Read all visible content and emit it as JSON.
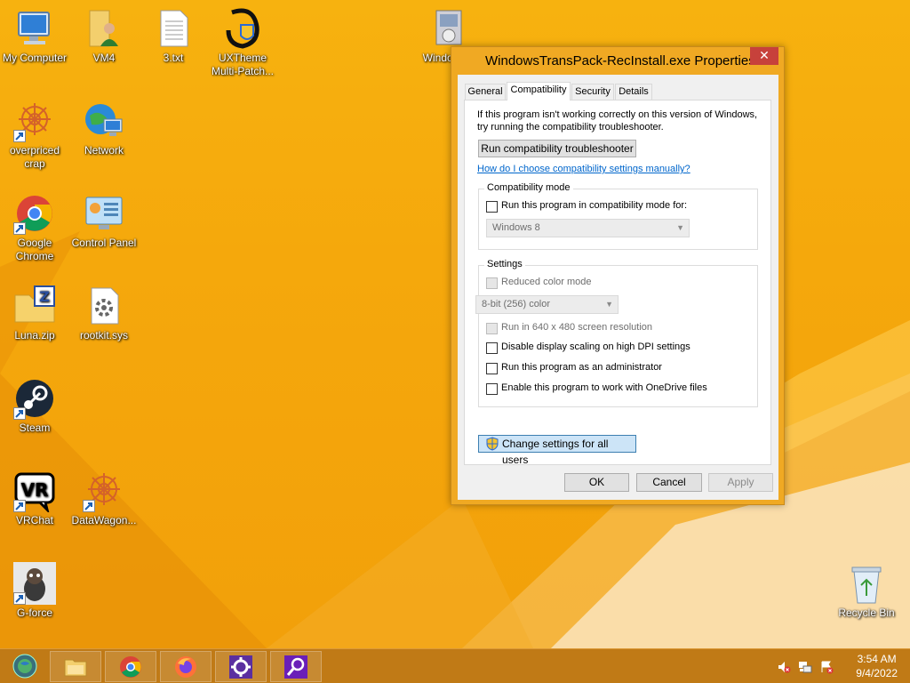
{
  "desktop": {
    "icons": [
      {
        "label": "My Computer",
        "icon": "computer-icon"
      },
      {
        "label": "VM4",
        "icon": "user-folder-icon"
      },
      {
        "label": "3.txt",
        "icon": "text-file-icon"
      },
      {
        "label": "UXTheme Multi-Patch...",
        "icon": "uxtheme-icon"
      },
      {
        "label": "Windows...",
        "icon": "installer-icon"
      },
      {
        "label": "overpriced crap",
        "icon": "starburst-icon"
      },
      {
        "label": "Network",
        "icon": "network-icon"
      },
      {
        "label": "Google Chrome",
        "icon": "chrome-icon"
      },
      {
        "label": "Control Panel",
        "icon": "control-panel-icon"
      },
      {
        "label": "Luna.zip",
        "icon": "zip-folder-icon"
      },
      {
        "label": "rootkit.sys",
        "icon": "sys-file-icon"
      },
      {
        "label": "Steam",
        "icon": "steam-icon"
      },
      {
        "label": "VRChat",
        "icon": "vrchat-icon"
      },
      {
        "label": "DataWagon...",
        "icon": "starburst-icon"
      },
      {
        "label": "G-force",
        "icon": "gforce-icon"
      },
      {
        "label": "Recycle Bin",
        "icon": "recycle-bin-icon"
      }
    ]
  },
  "dialog": {
    "title": "WindowsTransPack-RecInstall.exe Properties",
    "close_label": "✕",
    "tabs": [
      "General",
      "Compatibility",
      "Security",
      "Details"
    ],
    "active_tab": "Compatibility",
    "intro_line1": "If this program isn't working correctly on this version of Windows,",
    "intro_line2": "try running the compatibility troubleshooter.",
    "troubleshooter_button": "Run compatibility troubleshooter",
    "manual_link": "How do I choose compatibility settings manually?",
    "compat_mode": {
      "legend": "Compatibility mode",
      "checkbox_label": "Run this program in compatibility mode for:",
      "checked": false,
      "os_select": "Windows 8"
    },
    "settings": {
      "legend": "Settings",
      "reduced_color_label": "Reduced color mode",
      "color_select": "8-bit (256) color",
      "res_label": "Run in 640 x 480 screen resolution",
      "dpi_label": "Disable display scaling on high DPI settings",
      "admin_label": "Run this program as an administrator",
      "onedrive_label": "Enable this program to work with OneDrive files"
    },
    "change_all_button": "Change settings for all users",
    "ok_button": "OK",
    "cancel_button": "Cancel",
    "apply_button": "Apply"
  },
  "taskbar": {
    "apps": [
      "start-orb-icon",
      "file-explorer-icon",
      "chrome-icon",
      "firefox-icon",
      "settings-icon",
      "search-icon"
    ],
    "time": "3:54 AM",
    "date": "9/4/2022"
  },
  "colors": {
    "wallpaper": "#f5a80c",
    "dialog_frame": "#f0a923",
    "close_button": "#c7413b",
    "link": "#0066cc",
    "taskbar": "#c07a16"
  }
}
